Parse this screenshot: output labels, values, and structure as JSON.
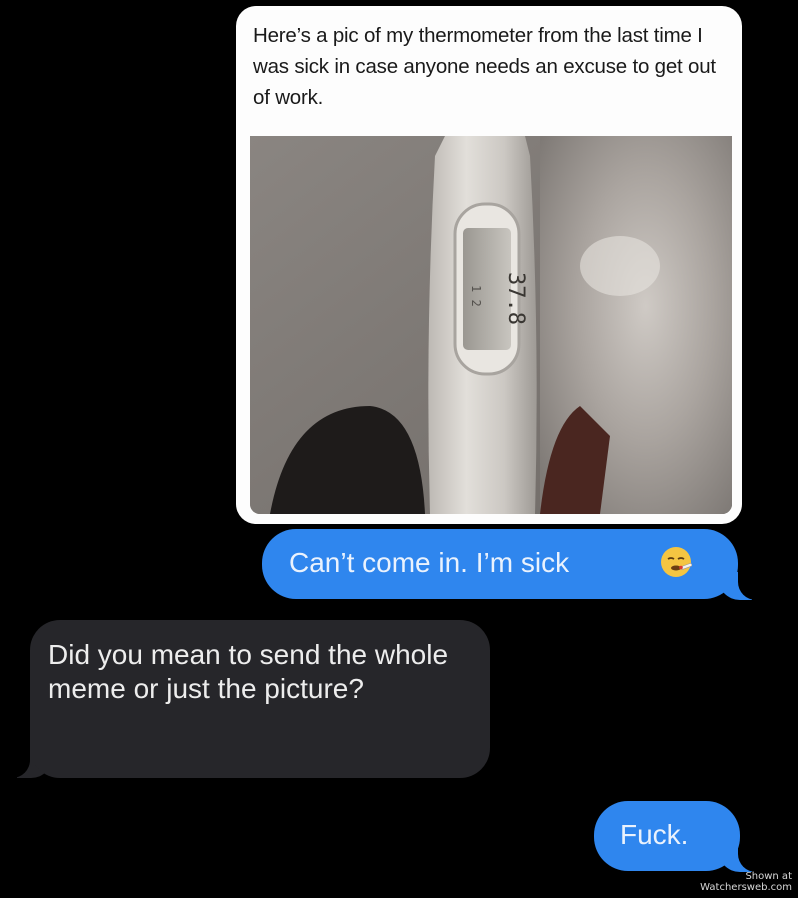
{
  "conversation": {
    "meme": {
      "caption": "Here’s a pic of my thermometer from the last time I was sick in case anyone needs an excuse to get out of work.",
      "image": "thermometer-photo"
    },
    "messages": [
      {
        "direction": "outgoing",
        "text": "Can’t come in. I’m sick",
        "emoji": "face-with-thermometer-icon"
      },
      {
        "direction": "incoming",
        "text": "Did you mean to send the whole meme or just the picture?"
      },
      {
        "direction": "outgoing",
        "text": "Fuck."
      }
    ]
  },
  "watermark": {
    "line1": "Shown at",
    "line2": "Watchersweb.com"
  },
  "colors": {
    "background": "#000000",
    "outgoing_bubble": "#2f86ee",
    "incoming_bubble": "#26262a",
    "card": "#fdfdfd"
  }
}
